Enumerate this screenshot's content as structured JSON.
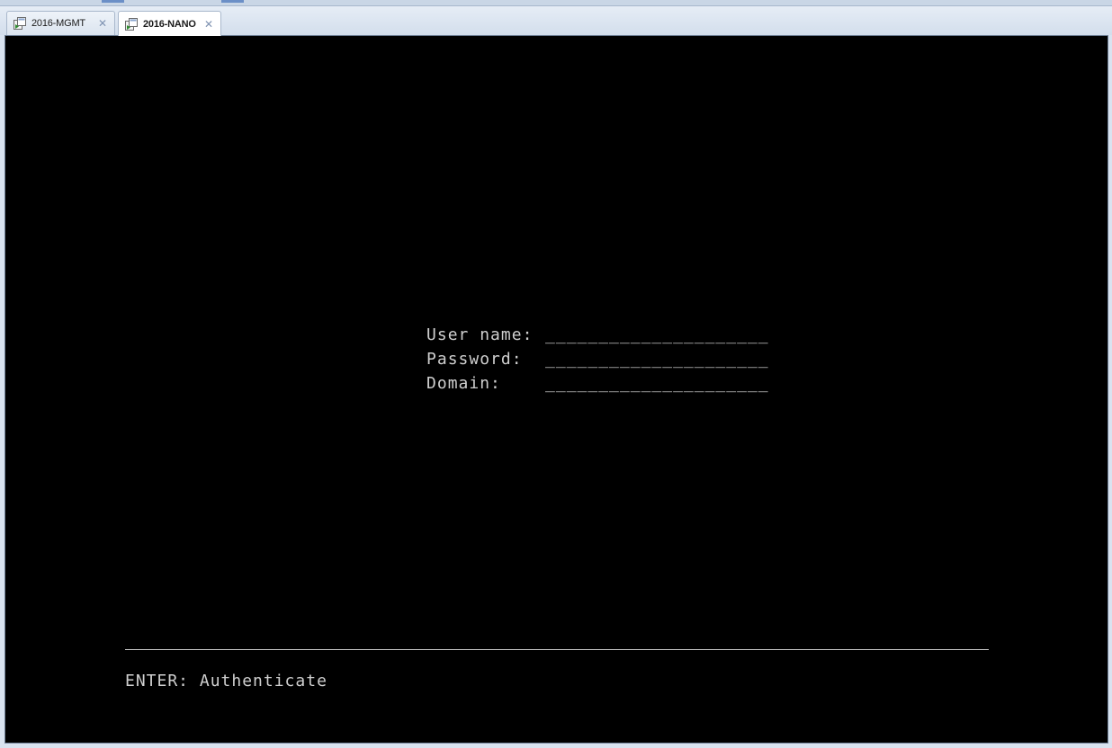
{
  "tabs": [
    {
      "label": "2016-MGMT",
      "active": false,
      "icon": "vm-console-icon"
    },
    {
      "label": "2016-NANO",
      "active": true,
      "icon": "vm-console-icon"
    }
  ],
  "tab_close_glyph": "✕",
  "login_form": {
    "username_label": "User name:",
    "username_value": "_____________________",
    "password_label": "Password:",
    "password_value": "_____________________",
    "domain_label": "Domain:",
    "domain_value": "_____________________"
  },
  "footer": {
    "hint": "ENTER: Authenticate"
  },
  "colors": {
    "console_bg": "#000000",
    "console_text": "#cfcfcf",
    "tab_bar": "#d3deec"
  }
}
